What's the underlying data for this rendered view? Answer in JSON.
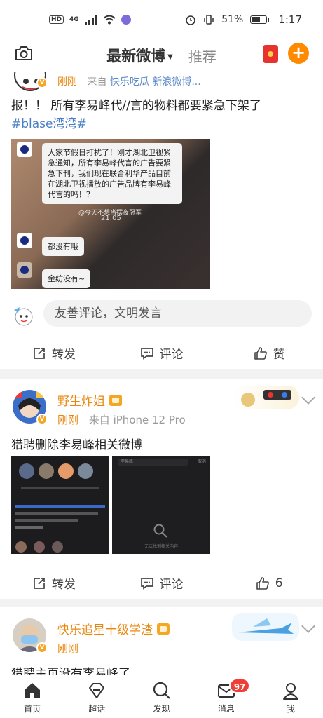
{
  "status_bar": {
    "hd": "HD",
    "network": "4G",
    "battery": "51%",
    "time": "1:17"
  },
  "top_nav": {
    "tab_latest": "最新微博",
    "tab_recommend": "推荐"
  },
  "posts": [
    {
      "time": "刚刚",
      "source_prefix": "来自",
      "source": "快乐吃瓜 新浪微博...",
      "text": "报！！ 所有李易峰代//言的物料都要紧急下架了",
      "hashtag": "#blase湾湾#",
      "image": {
        "bubble1": "大家节假日打扰了！刚才湖北卫视紧急通知，所有李易峰代言的广告要紧急下刊，我们现在联合利华产品目前在湖北卫视播放的广告品牌有李易峰代言的吗！？",
        "watermark": "@今天不想当摆夜冠军",
        "clock": "21:05",
        "bubble2": "都没有哦",
        "bubble3": "金纺没有~"
      },
      "comment_placeholder": "友善评论，文明发言",
      "actions": {
        "repost": "转发",
        "comment": "评论",
        "like": "赞"
      }
    },
    {
      "author": "野生炸姐",
      "time": "刚刚",
      "source_prefix": "来自",
      "source": "iPhone 12 Pro",
      "text": "猎聘删除李易峰相关微博",
      "thumb2": {
        "search_text": "李易峰",
        "cancel": "取消",
        "empty_text": "无法找到相关内容"
      },
      "actions": {
        "repost": "转发",
        "comment": "评论",
        "like": "6"
      }
    },
    {
      "author": "快乐追星十级学渣",
      "time": "刚刚",
      "text": "猎聘主页没有李易峰了"
    }
  ],
  "bottom_nav": {
    "home": "首页",
    "super_topic": "超话",
    "discover": "发现",
    "messages": "消息",
    "messages_badge": "97",
    "me": "我"
  }
}
